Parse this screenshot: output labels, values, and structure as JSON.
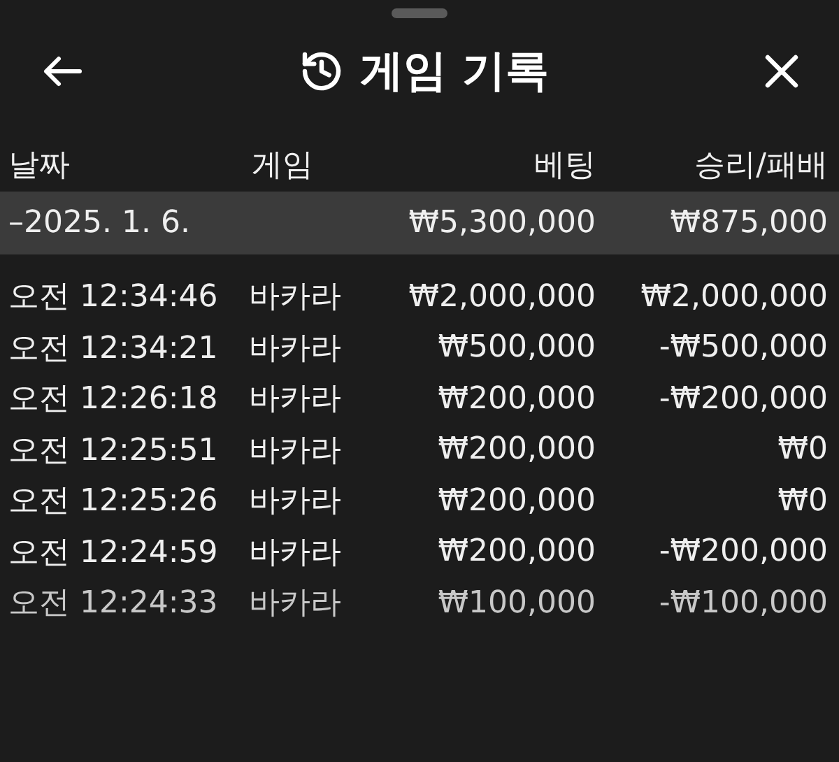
{
  "header": {
    "title": "게임 기록"
  },
  "table": {
    "columns": [
      "날짜",
      "게임",
      "베팅",
      "승리/패배"
    ],
    "group": {
      "date": "–2025. 1. 6.",
      "bet": "₩5,300,000",
      "result": "₩875,000"
    },
    "rows": [
      {
        "time": "오전 12:34:46",
        "game": "바카라",
        "bet": "₩2,000,000",
        "result": "₩2,000,000"
      },
      {
        "time": "오전 12:34:21",
        "game": "바카라",
        "bet": "₩500,000",
        "result": "-₩500,000"
      },
      {
        "time": "오전 12:26:18",
        "game": "바카라",
        "bet": "₩200,000",
        "result": "-₩200,000"
      },
      {
        "time": "오전 12:25:51",
        "game": "바카라",
        "bet": "₩200,000",
        "result": "₩0"
      },
      {
        "time": "오전 12:25:26",
        "game": "바카라",
        "bet": "₩200,000",
        "result": "₩0"
      },
      {
        "time": "오전 12:24:59",
        "game": "바카라",
        "bet": "₩200,000",
        "result": "-₩200,000"
      },
      {
        "time": "오전 12:24:33",
        "game": "바카라",
        "bet": "₩100,000",
        "result": "-₩100,000"
      }
    ]
  }
}
